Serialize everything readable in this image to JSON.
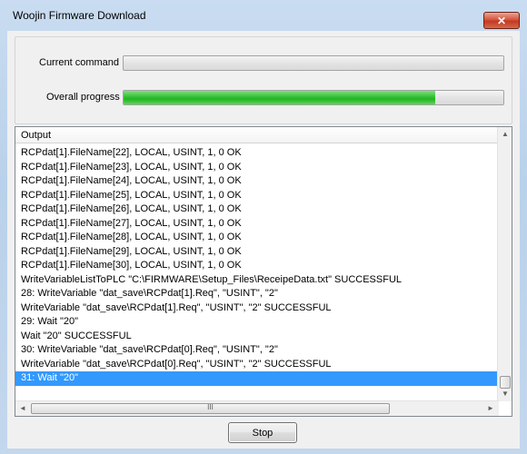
{
  "window": {
    "title": "Woojin Firmware Download",
    "close_glyph": "✕"
  },
  "progress": {
    "current_label": "Current command",
    "current_value": 0,
    "overall_label": "Overall progress",
    "overall_value": 0.82
  },
  "output": {
    "header": "Output",
    "rows": [
      "RCPdat[1].FileName[22], LOCAL, USINT, 1, 0  OK",
      "RCPdat[1].FileName[23], LOCAL, USINT, 1, 0  OK",
      "RCPdat[1].FileName[24], LOCAL, USINT, 1, 0  OK",
      "RCPdat[1].FileName[25], LOCAL, USINT, 1, 0  OK",
      "RCPdat[1].FileName[26], LOCAL, USINT, 1, 0  OK",
      "RCPdat[1].FileName[27], LOCAL, USINT, 1, 0  OK",
      "RCPdat[1].FileName[28], LOCAL, USINT, 1, 0  OK",
      "RCPdat[1].FileName[29], LOCAL, USINT, 1, 0  OK",
      "RCPdat[1].FileName[30], LOCAL, USINT, 1, 0  OK",
      "WriteVariableListToPLC \"C:\\FIRMWARE\\Setup_Files\\ReceipeData.txt\" SUCCESSFUL",
      "28: WriteVariable \"dat_save\\RCPdat[1].Req\", \"USINT\", \"2\"",
      "WriteVariable \"dat_save\\RCPdat[1].Req\", \"USINT\", \"2\" SUCCESSFUL",
      "29: Wait \"20\"",
      "Wait \"20\" SUCCESSFUL",
      "30: WriteVariable \"dat_save\\RCPdat[0].Req\", \"USINT\", \"2\"",
      "WriteVariable \"dat_save\\RCPdat[0].Req\", \"USINT\", \"2\" SUCCESSFUL",
      "31: Wait \"20\""
    ],
    "selected_index": 16
  },
  "scroll": {
    "up_arrow": "▲",
    "down_arrow": "▼",
    "left_arrow": "◄",
    "right_arrow": "►",
    "grip": "III"
  },
  "buttons": {
    "stop_label": "Stop"
  },
  "colors": {
    "progress_green": "#22b422",
    "selection_blue": "#3399ff"
  }
}
